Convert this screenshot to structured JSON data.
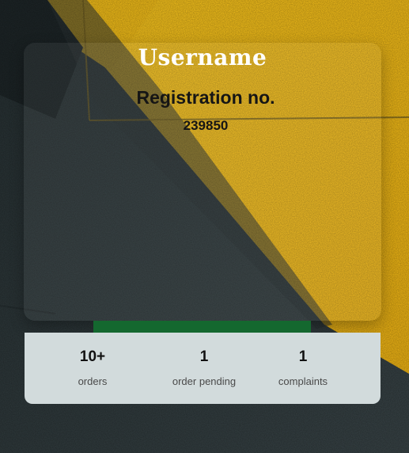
{
  "profile": {
    "username": "Username",
    "registration_label": "Registration no.",
    "registration_number": "239850"
  },
  "stats": [
    {
      "value": "10+",
      "label": "orders"
    },
    {
      "value": "1",
      "label": "order pending"
    },
    {
      "value": "1",
      "label": "complaints"
    }
  ],
  "colors": {
    "wall_yellow": "#f4bd1c",
    "wall_dark": "#2e3739",
    "accent_green": "#14682f",
    "stats_bg": "#d2dbdc"
  }
}
